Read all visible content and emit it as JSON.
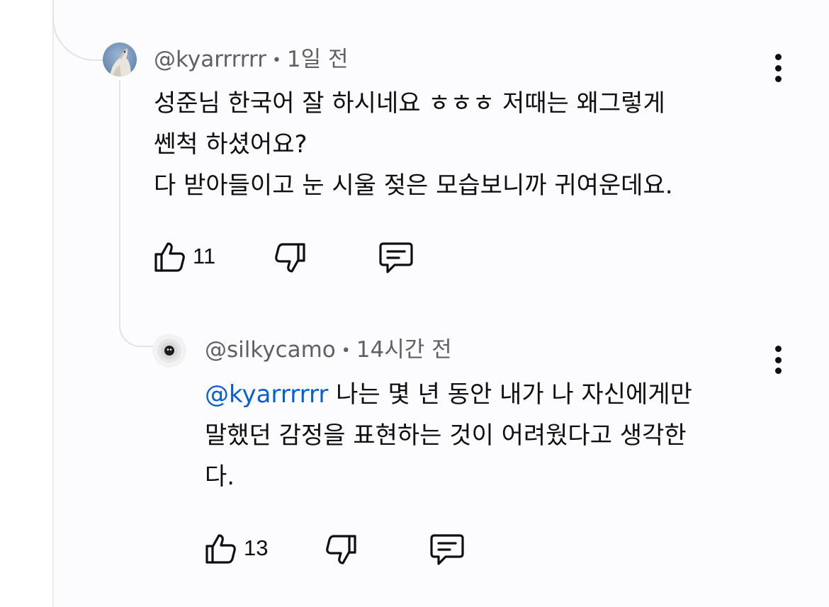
{
  "comment": {
    "author": "@kyarrrrrr",
    "time": "1일 전",
    "lines": [
      "성준님 한국어 잘 하시네요 ㅎㅎㅎ 저때는 왜그렇게",
      "쎈척 하셨어요?",
      "다 받아들이고 눈 시울 젖은 모습보니까 귀여운데요."
    ],
    "likes": "11"
  },
  "reply": {
    "author": "@silkycamo",
    "time": "14시간 전",
    "mention": "@kyarrrrrr",
    "lines": [
      " 나는 몇 년 동안 내가 나 자신에게만",
      "말했던 감정을 표현하는 것이 어려웠다고 생각한",
      "다."
    ],
    "likes": "13"
  },
  "separator": "•",
  "icons": {
    "like": "thumb-up-icon",
    "dislike": "thumb-down-icon",
    "reply": "comment-reply-icon",
    "more": "more-vertical-icon"
  },
  "colors": {
    "text": "#0f0f0f",
    "meta": "#606060",
    "mention": "#065fd4"
  }
}
